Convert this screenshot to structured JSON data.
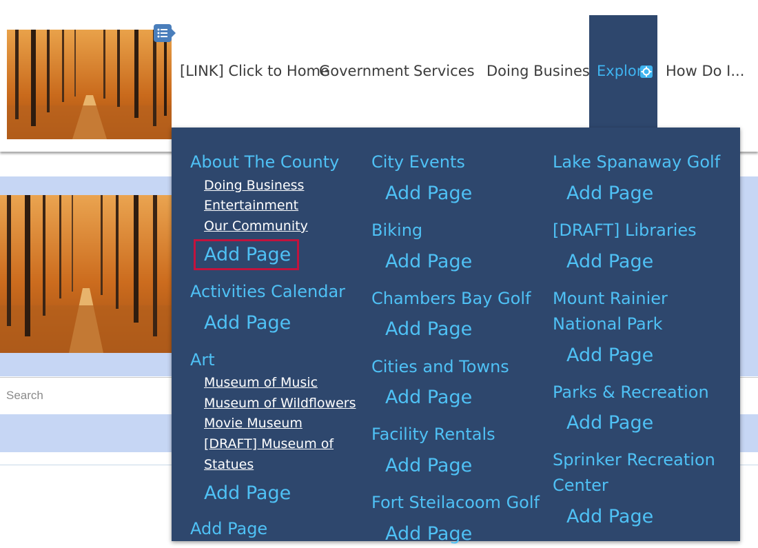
{
  "header": {
    "nav": [
      {
        "label": "[LINK] Click to Home"
      },
      {
        "label": "Government"
      },
      {
        "label": "Services"
      },
      {
        "label": "Doing Business"
      },
      {
        "label": "Explore"
      },
      {
        "label": "How Do I..."
      }
    ]
  },
  "search": {
    "placeholder": "Search"
  },
  "dropdown": {
    "col1": {
      "about": "About The County",
      "about_links": [
        "Doing Business",
        "Entertainment",
        "Our Community"
      ],
      "about_add": "Add Page",
      "activities": "Activities Calendar",
      "activities_add": "Add Page",
      "art": "Art",
      "art_links": [
        "Museum of Music",
        "Museum of Wildflowers",
        "Movie Museum",
        "[DRAFT] Museum of",
        "Statues"
      ],
      "art_add": "Add Page",
      "bottom_add": "Add Page"
    },
    "col2": {
      "items": [
        {
          "title": "City Events",
          "add": "Add Page"
        },
        {
          "title": "Biking",
          "add": "Add Page"
        },
        {
          "title": "Chambers Bay Golf",
          "add": "Add Page"
        },
        {
          "title": "Cities and Towns",
          "add": "Add Page"
        },
        {
          "title": "Facility Rentals",
          "add": "Add Page"
        },
        {
          "title": "Fort Steilacoom Golf",
          "add": "Add Page"
        }
      ]
    },
    "col3": {
      "lake": "Lake Spanaway Golf",
      "lake_add": "Add Page",
      "libraries": "[DRAFT] Libraries",
      "libraries_add": "Add Page",
      "rainier1": "Mount Rainier",
      "rainier2": "National Park",
      "rainier_add": "Add Page",
      "parks": "Parks & Recreation",
      "parks_add": "Add Page",
      "sprinker1": "Sprinker Recreation",
      "sprinker2": "Center",
      "sprinker_add": "Add Page"
    }
  }
}
